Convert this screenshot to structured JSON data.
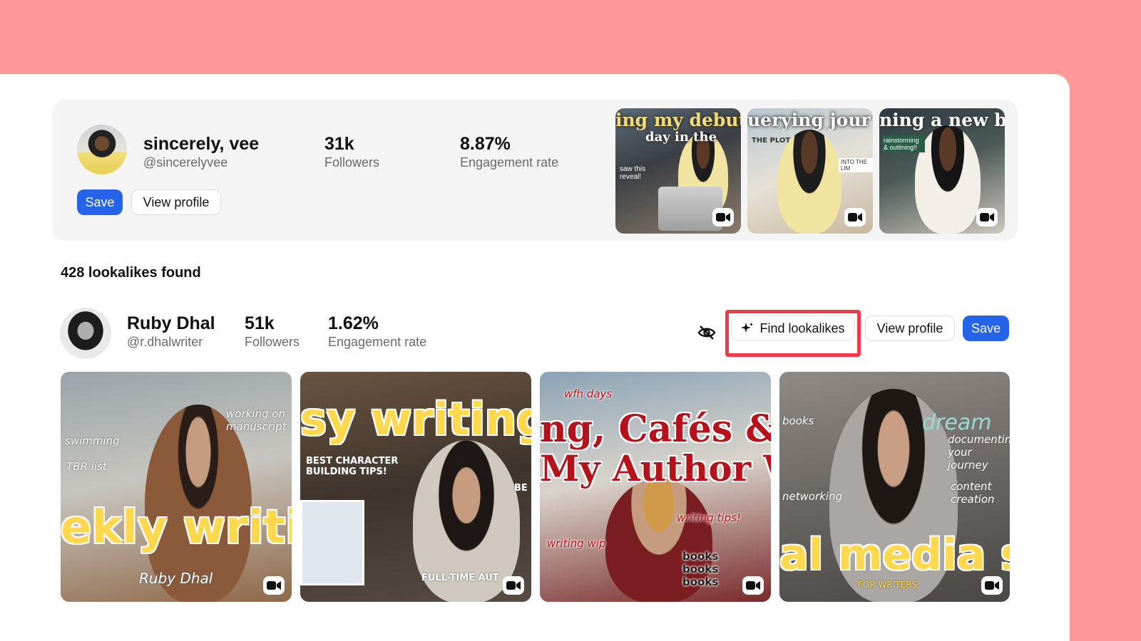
{
  "seed": {
    "name": "sincerely, vee",
    "handle": "@sincerelyvee",
    "followers": "31k",
    "followers_label": "Followers",
    "engagement": "8.87%",
    "engagement_label": "Engagement rate",
    "save_label": "Save",
    "view_profile_label": "View profile",
    "thumbnails": [
      {
        "caption": "ing my debut n",
        "caption2": "day in the",
        "overlay": "saw this reveal!",
        "icon": "video-icon"
      },
      {
        "caption": "uerying jour",
        "caption2": "THE PLOT",
        "overlay": "INTO THE LIM",
        "icon": "video-icon"
      },
      {
        "caption": "ning a new b",
        "caption2": "rainstorming & outlining!!",
        "overlay": "",
        "icon": "video-icon"
      }
    ]
  },
  "lookalikes": {
    "count_text": "428 lookalikes found",
    "items": [
      {
        "name": "Ruby Dhal",
        "handle": "@r.dhalwriter",
        "followers": "51k",
        "followers_label": "Followers",
        "engagement": "1.62%",
        "engagement_label": "Engagement rate",
        "find_lookalikes_label": "Find lookalikes",
        "view_profile_label": "View profile",
        "save_label": "Save",
        "thumbnails": [
          {
            "caption": "ekly writing v",
            "doodles": [
              "swimming",
              "TBR list",
              "working on manuscript",
              "Ruby Dhal"
            ],
            "icon": "video-icon"
          },
          {
            "caption": "sy writing vlo",
            "doodles": [
              "BEST CHARACTER BUILDING TIPS!",
              "FULL-TIME AUT",
              "BE"
            ],
            "icon": "video-icon"
          },
          {
            "caption": "ng, Cafés & Cl",
            "caption2": "My Author Weel",
            "doodles": [
              "wfh days",
              "writing tips!",
              "writing wip",
              "books books books"
            ],
            "icon": "video-icon"
          },
          {
            "caption": "al media secr",
            "doodles": [
              "books",
              "dream",
              "documenting your journey",
              "networking",
              "content creation",
              "FOR WRITERS"
            ],
            "icon": "video-icon"
          }
        ]
      }
    ]
  },
  "colors": {
    "background": "#ff9999",
    "accent": "#2563eb",
    "highlight": "#f03a4a"
  }
}
